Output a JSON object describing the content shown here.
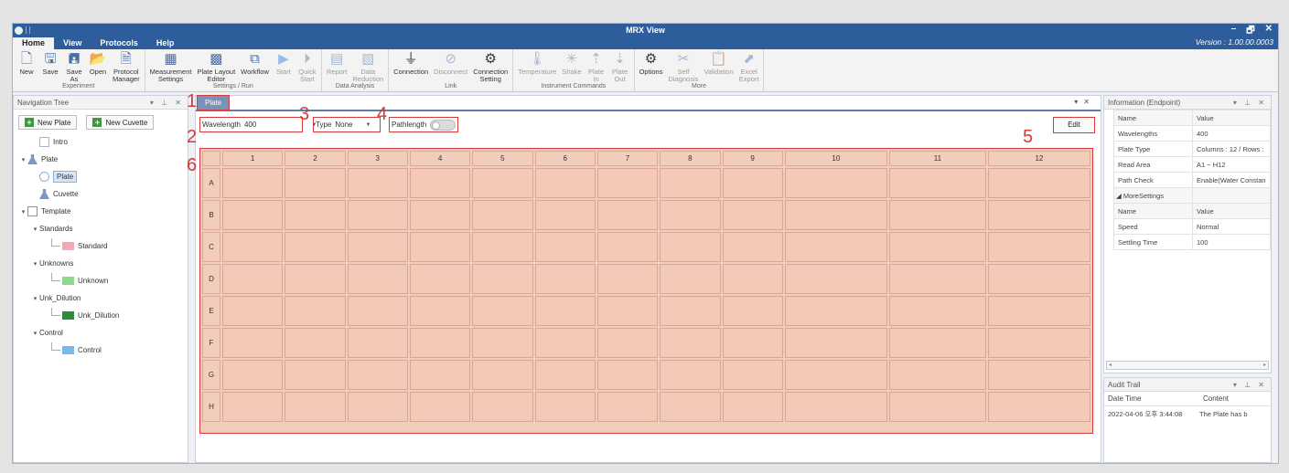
{
  "window": {
    "title": "MRX View",
    "version": "Version : 1.00.00.0003",
    "controls": [
      "–",
      "🗗",
      "✕"
    ]
  },
  "menu": {
    "tabs": [
      "Home",
      "View",
      "Protocols",
      "Help"
    ]
  },
  "ribbon": {
    "groups": [
      {
        "label": "Experiment",
        "buttons": [
          {
            "label": "New",
            "icon": "new-icon",
            "enabled": true
          },
          {
            "label": "Save",
            "icon": "save-icon",
            "enabled": true
          },
          {
            "label": "Save\nAs",
            "icon": "save-as-icon",
            "enabled": true
          },
          {
            "label": "Open",
            "icon": "open-folder-icon",
            "enabled": true
          },
          {
            "label": "Protocol\nManager",
            "icon": "protocol-manager-icon",
            "enabled": true
          }
        ]
      },
      {
        "label": "Settings / Run",
        "buttons": [
          {
            "label": "Measurement\nSettings",
            "icon": "measurement-settings-icon",
            "enabled": true
          },
          {
            "label": "Plate Layout\nEditor",
            "icon": "plate-layout-icon",
            "enabled": true
          },
          {
            "label": "Workflow",
            "icon": "workflow-icon",
            "enabled": true
          },
          {
            "label": "Start",
            "icon": "play-icon",
            "enabled": false
          },
          {
            "label": "Quick\nStart",
            "icon": "quick-start-icon",
            "enabled": false
          }
        ]
      },
      {
        "label": "Data Analysis",
        "buttons": [
          {
            "label": "Report",
            "icon": "report-icon",
            "enabled": false
          },
          {
            "label": "Data\nReduction",
            "icon": "data-reduction-icon",
            "enabled": false
          }
        ]
      },
      {
        "label": "Link",
        "buttons": [
          {
            "label": "Connection",
            "icon": "plug-icon",
            "enabled": true
          },
          {
            "label": "Disconnect",
            "icon": "unplug-icon",
            "enabled": false
          },
          {
            "label": "Connection\nSetting",
            "icon": "plug-settings-icon",
            "enabled": true
          }
        ]
      },
      {
        "label": "Instrument Commands",
        "buttons": [
          {
            "label": "Temperature",
            "icon": "thermometer-icon",
            "enabled": false
          },
          {
            "label": "Shake",
            "icon": "shake-icon",
            "enabled": false
          },
          {
            "label": "Plate\nIn",
            "icon": "plate-in-icon",
            "enabled": false
          },
          {
            "label": "Plate\nOut",
            "icon": "plate-out-icon",
            "enabled": false
          }
        ]
      },
      {
        "label": "More",
        "buttons": [
          {
            "label": "Options",
            "icon": "gear-icon",
            "enabled": true
          },
          {
            "label": "Self\nDiagnosis",
            "icon": "tools-icon",
            "enabled": false
          },
          {
            "label": "Validation",
            "icon": "clipboard-icon",
            "enabled": false
          },
          {
            "label": "Excel\nExport",
            "icon": "excel-export-icon",
            "enabled": false
          }
        ]
      }
    ]
  },
  "nav": {
    "title": "Navigation Tree",
    "new_plate": "New Plate",
    "new_cuvette": "New Cuvette",
    "tree": [
      {
        "label": "Intro",
        "level": 1,
        "icon": "document-icon",
        "expander": ""
      },
      {
        "label": "Plate",
        "level": 0,
        "icon": "flask-icon",
        "expander": "▾"
      },
      {
        "label": "Plate",
        "level": 1,
        "icon": "plate-item-icon",
        "expander": "",
        "selected": true
      },
      {
        "label": "Cuvette",
        "level": 1,
        "icon": "flask-icon",
        "expander": ""
      },
      {
        "label": "Template",
        "level": 0,
        "icon": "template-icon",
        "expander": "▾"
      },
      {
        "label": "Standards",
        "level": 1,
        "icon": "",
        "expander": "▾"
      },
      {
        "label": "Standard",
        "level": 2,
        "swatch": "#f2a8b8"
      },
      {
        "label": "Unknowns",
        "level": 1,
        "icon": "",
        "expander": "▾"
      },
      {
        "label": "Unknown",
        "level": 2,
        "swatch": "#8fd68f"
      },
      {
        "label": "Unk_Dilution",
        "level": 1,
        "icon": "",
        "expander": "▾"
      },
      {
        "label": "Unk_Dilution",
        "level": 2,
        "swatch": "#2d8a3e"
      },
      {
        "label": "Control",
        "level": 1,
        "icon": "",
        "expander": "▾"
      },
      {
        "label": "Control",
        "level": 2,
        "swatch": "#7ab8e6"
      }
    ]
  },
  "doc": {
    "tab": "Plate"
  },
  "params": {
    "wavelength_label": "Wavelength",
    "wavelength_value": "400",
    "type_label": "Type",
    "type_value": "None",
    "pathlength_label": "Pathlength",
    "edit": "Edit"
  },
  "callouts": [
    "1",
    "2",
    "3",
    "4",
    "5",
    "6"
  ],
  "plate": {
    "columns": [
      "1",
      "2",
      "3",
      "4",
      "5",
      "6",
      "7",
      "8",
      "9",
      "10",
      "11",
      "12"
    ],
    "rows": [
      "A",
      "B",
      "C",
      "D",
      "E",
      "F",
      "G",
      "H"
    ]
  },
  "info": {
    "title": "Information (Endpoint)",
    "header": [
      "Name",
      "Value"
    ],
    "rows": [
      [
        "Wavelengths",
        "400"
      ],
      [
        "Plate Type",
        "Columns : 12 / Rows :"
      ],
      [
        "Read Area",
        "A1 ~ H12"
      ],
      [
        "Path Check",
        "Enable(Water Constan"
      ]
    ],
    "more_label": "MoreSettings",
    "more_header": [
      "Name",
      "Value"
    ],
    "more_rows": [
      [
        "Speed",
        "Normal"
      ],
      [
        "Settling Time",
        "100"
      ]
    ]
  },
  "audit": {
    "title": "Audit Trail",
    "header": [
      "Date Time",
      "Content"
    ],
    "rows": [
      [
        "2022-04-06 오후 3:44:08",
        "The Plate has b"
      ]
    ]
  },
  "colors": {
    "accent": "#2d5d9b",
    "callout": "#d23c3c",
    "well": "#f4c9b8"
  }
}
